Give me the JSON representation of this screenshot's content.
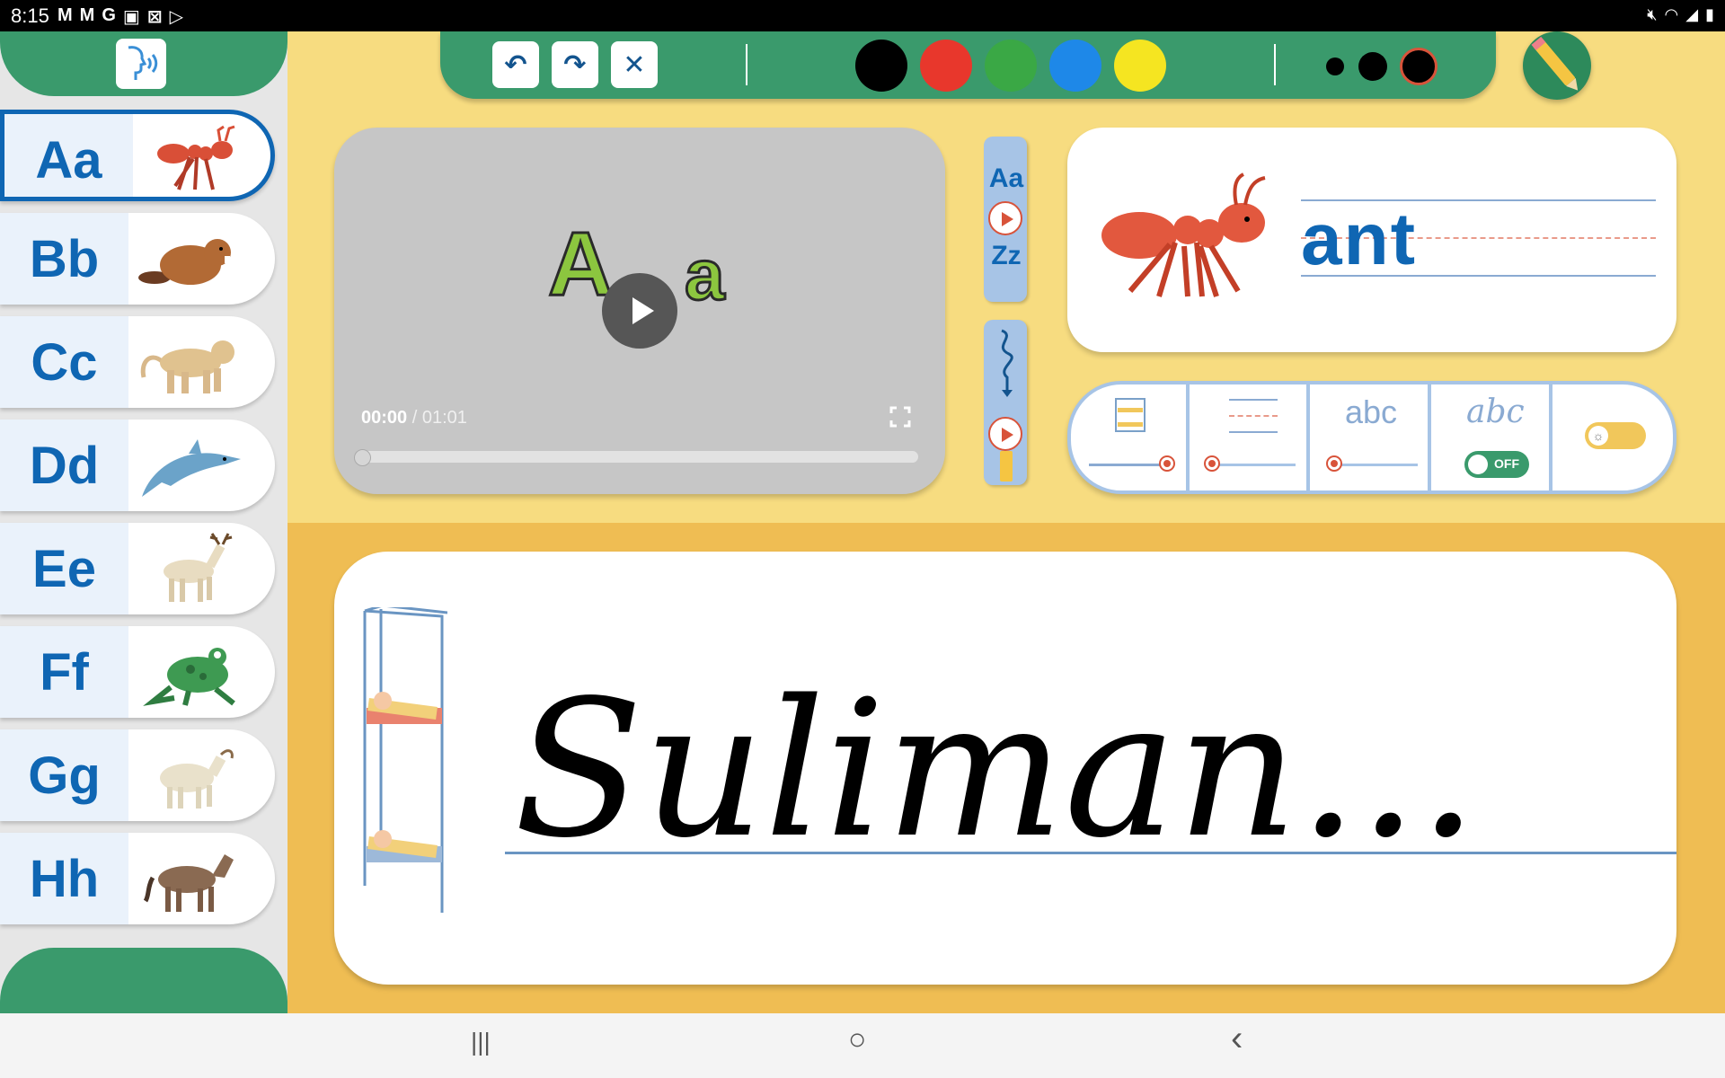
{
  "status_bar": {
    "time": "8:15",
    "left_icons": [
      "gmail-icon",
      "gmail-icon",
      "google-icon",
      "gallery-icon",
      "close-box-icon",
      "play-store-icon"
    ],
    "right_icons": [
      "mute-icon",
      "wifi-icon",
      "signal-icon",
      "battery-icon"
    ]
  },
  "sidebar": {
    "speak_button_icon": "speaking-head-icon",
    "letters": [
      {
        "letter": "Aa",
        "animal": "ant",
        "selected": true
      },
      {
        "letter": "Bb",
        "animal": "beaver",
        "selected": false
      },
      {
        "letter": "Cc",
        "animal": "cougar",
        "selected": false
      },
      {
        "letter": "Dd",
        "animal": "dolphin",
        "selected": false
      },
      {
        "letter": "Ee",
        "animal": "elk",
        "selected": false
      },
      {
        "letter": "Ff",
        "animal": "frog",
        "selected": false
      },
      {
        "letter": "Gg",
        "animal": "goat",
        "selected": false
      },
      {
        "letter": "Hh",
        "animal": "horse",
        "selected": false
      }
    ]
  },
  "toolbar": {
    "undo_icon": "undo-icon",
    "redo_icon": "redo-icon",
    "clear_icon": "close-icon",
    "colors": [
      "#000000",
      "#e8372c",
      "#3aa845",
      "#1e88e8",
      "#f5e521"
    ],
    "pen_sizes": [
      "small",
      "medium",
      "large"
    ],
    "selected_pen_size": "large",
    "selected_color": "#000000"
  },
  "video": {
    "current_time": "00:00",
    "total_time": "/ 01:01",
    "title_upper": "A",
    "title_lower": "a",
    "progress": 0
  },
  "side_buttons": {
    "alphabet_top": "Aa",
    "alphabet_bottom": "Zz"
  },
  "word_card": {
    "word": "ant"
  },
  "settings": {
    "abc_print": "abc",
    "abc_cursive": "abc",
    "cursive_toggle": "OFF"
  },
  "board": {
    "handwriting": "Suliman..."
  },
  "nav": {
    "recent": "|||",
    "home": "○",
    "back": "‹"
  }
}
